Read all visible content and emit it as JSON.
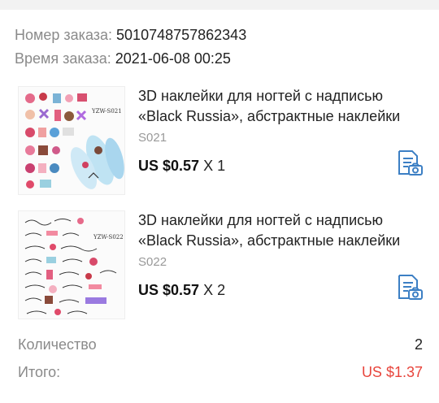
{
  "order": {
    "number_label": "Номер заказа:",
    "number_value": "5010748757862343",
    "time_label": "Время заказа:",
    "time_value": "2021-06-08 00:25"
  },
  "items": [
    {
      "thumb_label": "YZW-S021",
      "title": "3D наклейки для ногтей с надписью «Black Russia», абстрактные наклейки",
      "sku": "S021",
      "price": "US $0.57",
      "qty": "X 1",
      "icon": "document-camera-icon"
    },
    {
      "thumb_label": "YZW-S022",
      "title": "3D наклейки для ногтей с надписью «Black Russia», абстрактные наклейки",
      "sku": "S022",
      "price": "US $0.57",
      "qty": "X 2",
      "icon": "document-camera-icon"
    }
  ],
  "summary": {
    "qty_label": "Количество",
    "qty_value": "2",
    "total_label": "Итого:",
    "total_value": "US $1.37"
  },
  "colors": {
    "accent_price": "#e8453c",
    "icon_blue": "#3c7fc4",
    "label_gray": "#8a8a8a"
  }
}
